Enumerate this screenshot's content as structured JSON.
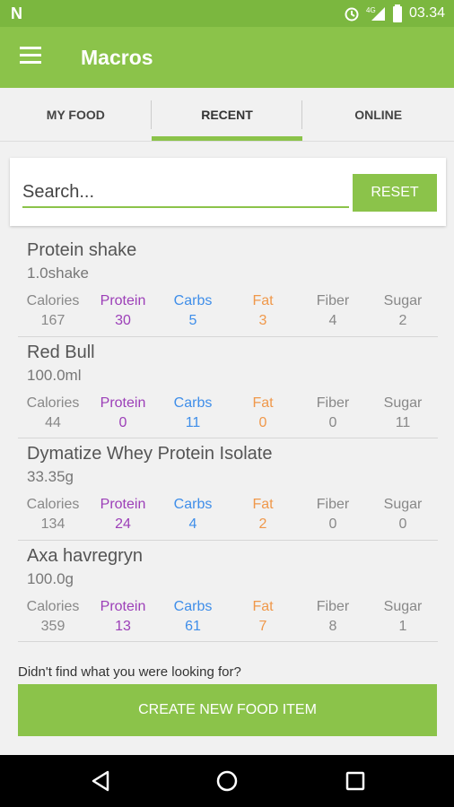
{
  "status_bar": {
    "time": "03.34",
    "network": "4G"
  },
  "app_bar": {
    "title": "Macros"
  },
  "tabs": [
    {
      "label": "MY FOOD",
      "active": false
    },
    {
      "label": "RECENT",
      "active": true
    },
    {
      "label": "ONLINE",
      "active": false
    }
  ],
  "search": {
    "placeholder": "Search...",
    "reset_label": "RESET"
  },
  "macro_labels": {
    "calories": "Calories",
    "protein": "Protein",
    "carbs": "Carbs",
    "fat": "Fat",
    "fiber": "Fiber",
    "sugar": "Sugar"
  },
  "foods": [
    {
      "name": "Protein shake",
      "amount": "1.0shake",
      "calories": "167",
      "protein": "30",
      "carbs": "5",
      "fat": "3",
      "fiber": "4",
      "sugar": "2"
    },
    {
      "name": "Red Bull",
      "amount": "100.0ml",
      "calories": "44",
      "protein": "0",
      "carbs": "11",
      "fat": "0",
      "fiber": "0",
      "sugar": "11"
    },
    {
      "name": "Dymatize Whey Protein Isolate",
      "amount": "33.35g",
      "calories": "134",
      "protein": "24",
      "carbs": "4",
      "fat": "2",
      "fiber": "0",
      "sugar": "0"
    },
    {
      "name": "Axa havregryn",
      "amount": "100.0g",
      "calories": "359",
      "protein": "13",
      "carbs": "61",
      "fat": "7",
      "fiber": "8",
      "sugar": "1"
    }
  ],
  "not_found_text": "Didn't find what you were looking for?",
  "create_button_label": "CREATE NEW FOOD ITEM",
  "colors": {
    "accent": "#8bc34a",
    "protein": "#9c3fb8",
    "carbs": "#3f8ee9",
    "fat": "#f0984a"
  }
}
